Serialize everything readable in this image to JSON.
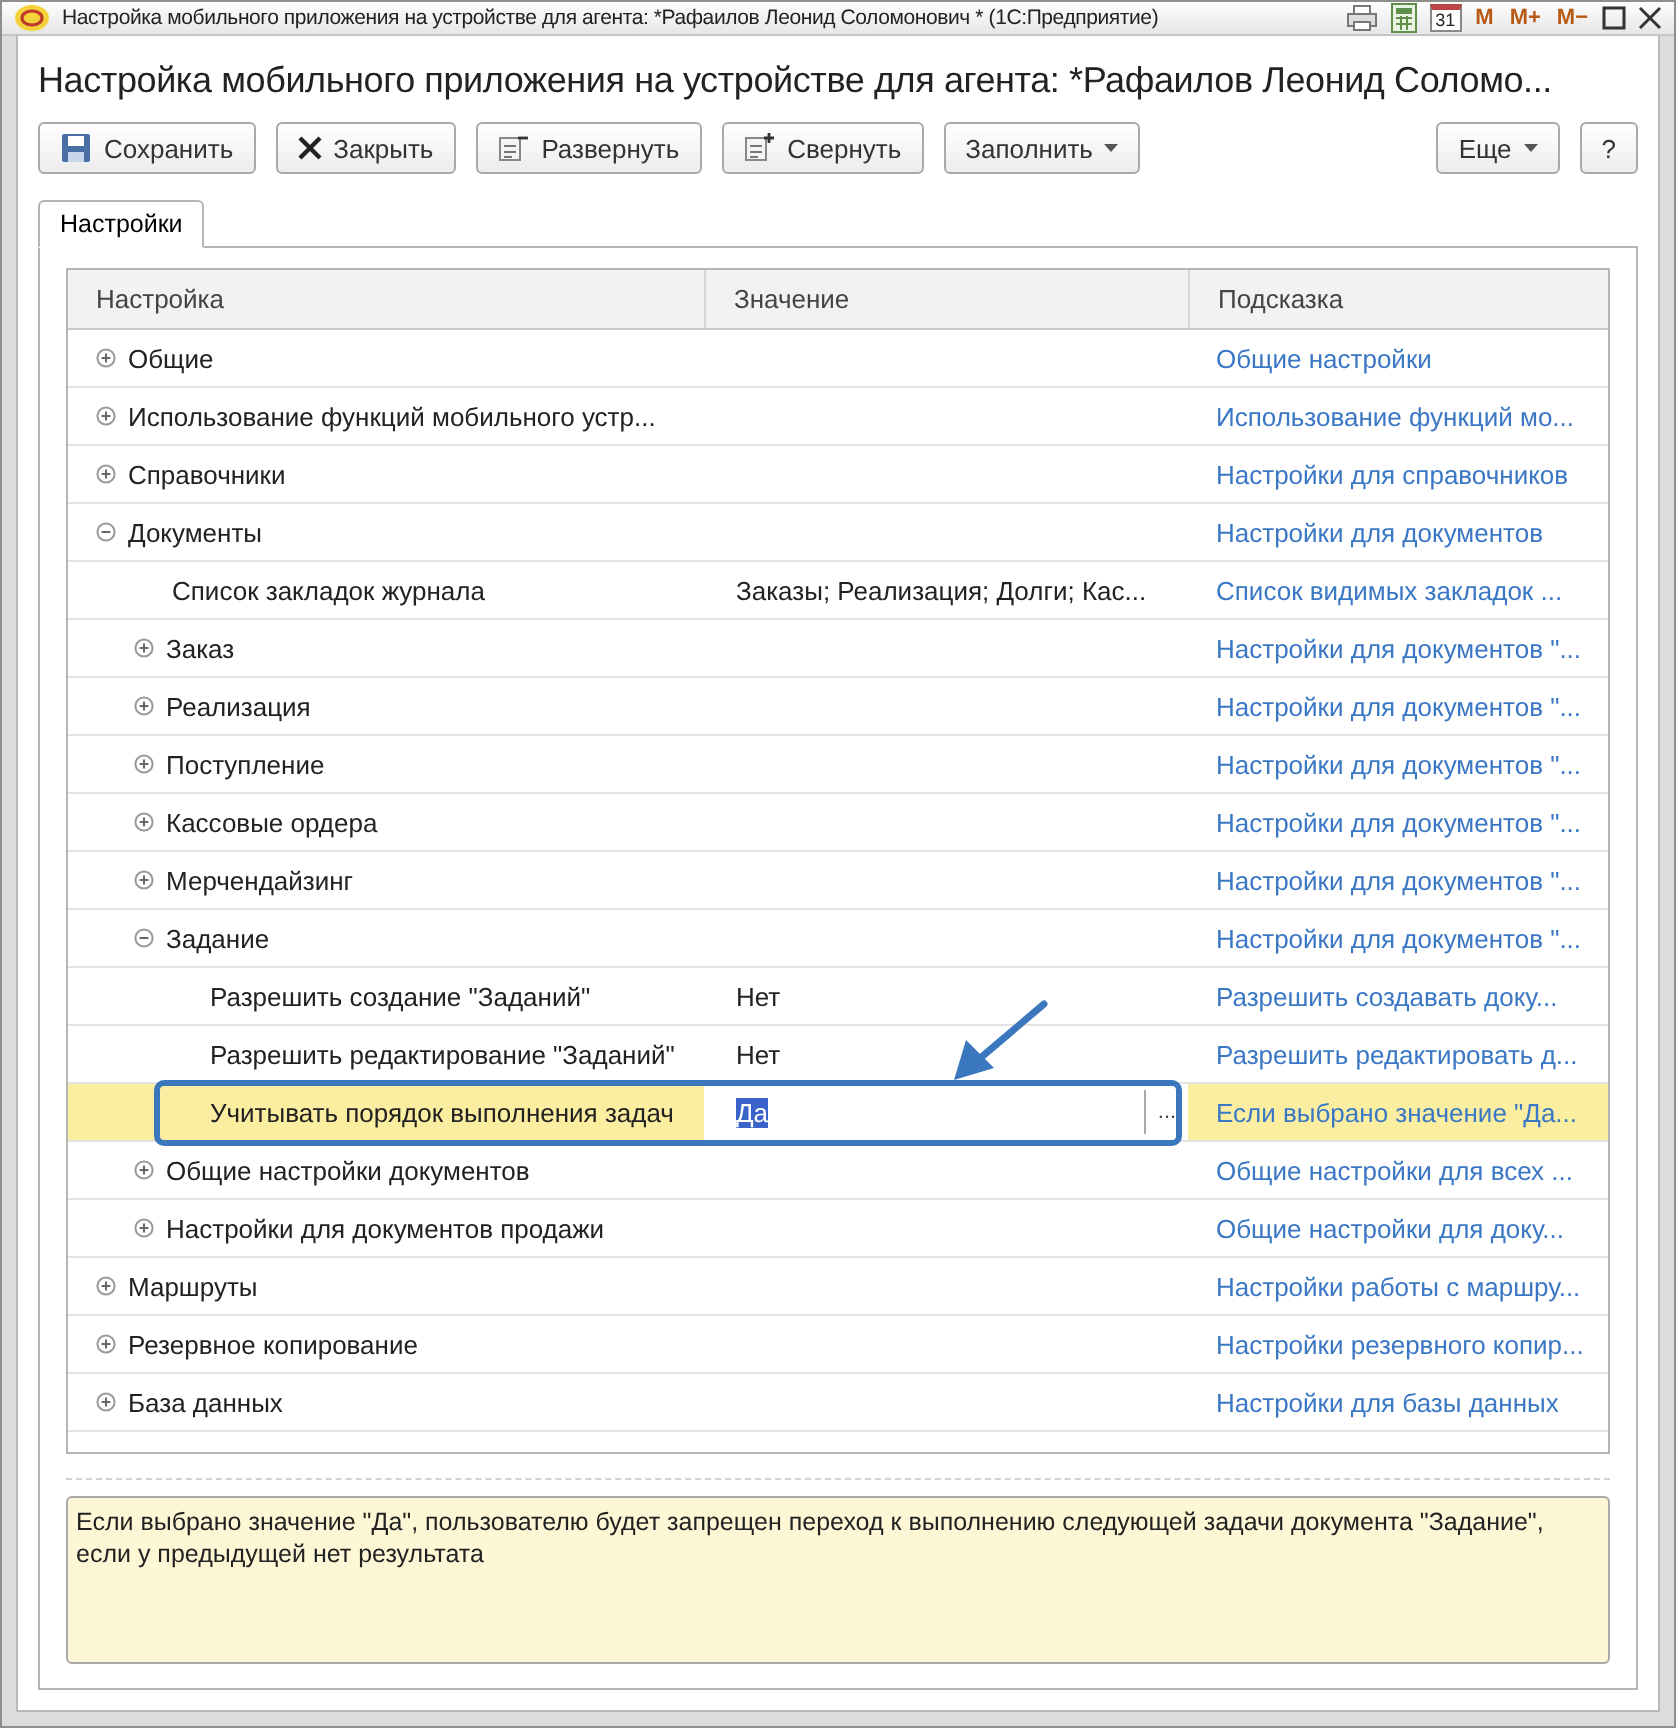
{
  "title_bar": {
    "title": "Настройка мобильного приложения на устройстве для агента: *Рафаилов Леонид Соломонович *  (1С:Предприятие)",
    "calendar_day": "31",
    "memory_buttons": [
      "M",
      "M+",
      "M−"
    ]
  },
  "form_title": "Настройка мобильного приложения на устройстве для агента: *Рафаилов Леонид Соломо...",
  "toolbar": {
    "buttons": [
      {
        "label": "Сохранить",
        "kind": "save"
      },
      {
        "label": "Закрыть",
        "kind": "close"
      },
      {
        "label": "Развернуть",
        "kind": "expand"
      },
      {
        "label": "Свернуть",
        "kind": "collapse"
      },
      {
        "label": "Заполнить",
        "kind": "menu"
      }
    ],
    "right_buttons": [
      {
        "label": "Еще",
        "kind": "menu"
      },
      {
        "label": "?",
        "kind": "plain"
      }
    ]
  },
  "tabs": [
    {
      "label": "Настройки",
      "selected": true
    }
  ],
  "table": {
    "columns": [
      "Настройка",
      "Значение",
      "Подсказка"
    ],
    "rows": [
      {
        "setting": "Общие",
        "hint": "Общие настройки",
        "expanded": false,
        "selected": false
      },
      {
        "setting": "Использование функций мобильного устр...",
        "hint": "Использование функций мо...",
        "expanded": false,
        "selected": false
      },
      {
        "setting": "Справочники",
        "hint": "Настройки для справочников",
        "expanded": false,
        "selected": false
      },
      {
        "setting": "Документы",
        "hint": "Настройки для документов",
        "expanded": true,
        "selected": false,
        "children": [
          {
            "setting": "Список закладок журнала",
            "value": "Заказы; Реализация; Долги; Кас...",
            "hint": "Список видимых закладок ...",
            "selected": false
          },
          {
            "setting": "Заказ",
            "hint": "Настройки для документов \"...",
            "expanded": false,
            "selected": false
          },
          {
            "setting": "Реализация",
            "hint": "Настройки для документов \"...",
            "expanded": false,
            "selected": false
          },
          {
            "setting": "Поступление",
            "hint": "Настройки для документов \"...",
            "expanded": false,
            "selected": false
          },
          {
            "setting": "Кассовые ордера",
            "hint": "Настройки для документов \"...",
            "expanded": false,
            "selected": false
          },
          {
            "setting": "Мерчендайзинг",
            "hint": "Настройки для документов \"...",
            "expanded": false,
            "selected": false
          },
          {
            "setting": "Задание",
            "hint": "Настройки для документов \"...",
            "expanded": true,
            "selected": false,
            "children": [
              {
                "setting": "Разрешить создание \"Заданий\"",
                "value": "Нет",
                "hint": "Разрешить создавать доку...",
                "selected": false
              },
              {
                "setting": "Разрешить редактирование \"Заданий\"",
                "value": "Нет",
                "hint": "Разрешить редактировать д...",
                "selected": false
              },
              {
                "setting": "Учитывать порядок выполнения задач",
                "value": "Да",
                "hint": "Если выбрано значение \"Да...",
                "selected": true,
                "choice_button": "..."
              }
            ]
          },
          {
            "setting": "Общие настройки документов",
            "hint": "Общие настройки для всех ...",
            "expanded": false,
            "selected": false
          },
          {
            "setting": "Настройки для документов продажи",
            "hint": "Общие настройки для доку...",
            "expanded": false,
            "selected": false
          }
        ]
      },
      {
        "setting": "Маршруты",
        "hint": "Настройки работы с маршру...",
        "expanded": false,
        "selected": false
      },
      {
        "setting": "Резервное копирование",
        "hint": "Настройки резервного копир...",
        "expanded": false,
        "selected": false
      },
      {
        "setting": "База данных",
        "hint": "Настройки для базы данных",
        "expanded": false,
        "selected": false
      }
    ]
  },
  "description": "Если выбрано значение \"Да\", пользователю будет запрещен переход к выполнению следующей задачи документа \"Задание\", если у предыдущей нет результата"
}
